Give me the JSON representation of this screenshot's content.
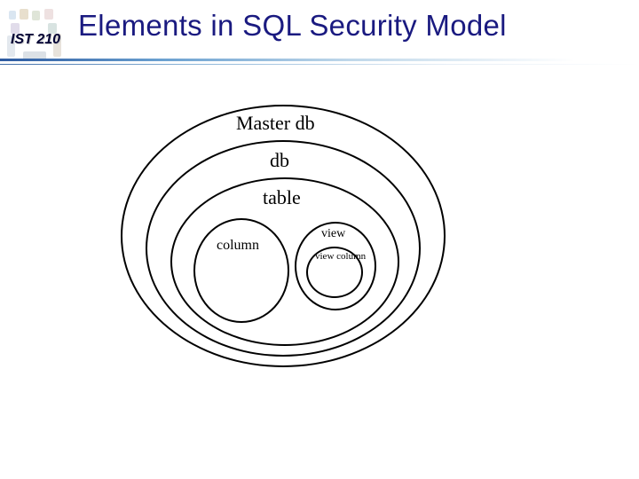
{
  "header": {
    "course_code": "IST 210",
    "title": "Elements in SQL Security Model"
  },
  "diagram": {
    "labels": {
      "master_db": "Master db",
      "db": "db",
      "table": "table",
      "column": "column",
      "view": "view",
      "view_column": "view\ncolumn"
    }
  },
  "chart_data": {
    "type": "diagram",
    "title": "Elements in SQL Security Model",
    "structure": "nested-ellipses",
    "hierarchy": [
      {
        "name": "Master db",
        "contains": [
          {
            "name": "db",
            "contains": [
              {
                "name": "table",
                "contains": [
                  {
                    "name": "column"
                  },
                  {
                    "name": "view",
                    "contains": [
                      {
                        "name": "view column"
                      }
                    ]
                  }
                ]
              }
            ]
          }
        ]
      }
    ]
  }
}
